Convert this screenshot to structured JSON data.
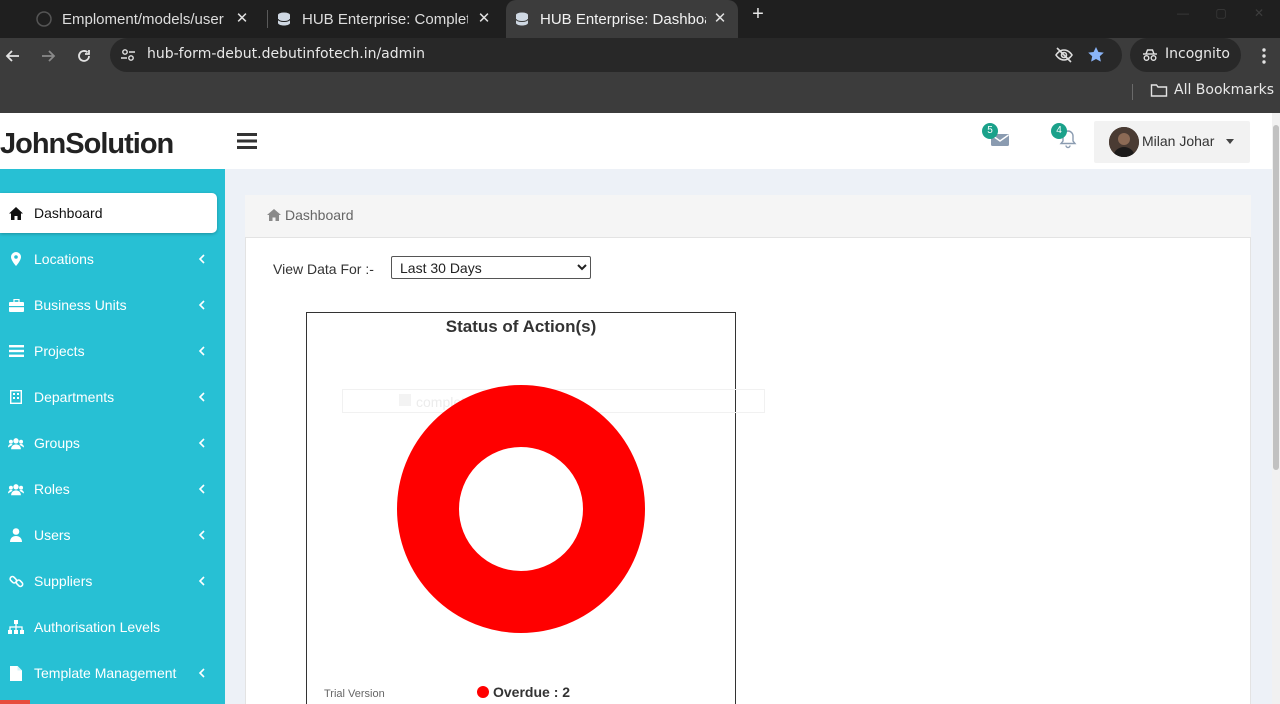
{
  "browser": {
    "tabs": [
      {
        "title": "Emploment/models/user",
        "active": false
      },
      {
        "title": "HUB Enterprise: Complete",
        "active": false
      },
      {
        "title": "HUB Enterprise: Dashboard",
        "active": true
      }
    ],
    "url": "hub-form-debut.debutinfotech.in/admin",
    "incognito_label": "Incognito",
    "bookmarks_label": "All Bookmarks"
  },
  "app": {
    "brand": "JohnSolution",
    "mail_count": "5",
    "notification_count": "4",
    "user_name": "Milan Johar"
  },
  "sidebar": {
    "items": [
      {
        "label": "Dashboard",
        "icon": "home-icon",
        "active": true,
        "has_submenu": false
      },
      {
        "label": "Locations",
        "icon": "map-marker-icon",
        "active": false,
        "has_submenu": true
      },
      {
        "label": "Business Units",
        "icon": "briefcase-icon",
        "active": false,
        "has_submenu": true
      },
      {
        "label": "Projects",
        "icon": "list-icon",
        "active": false,
        "has_submenu": true
      },
      {
        "label": "Departments",
        "icon": "building-icon",
        "active": false,
        "has_submenu": true
      },
      {
        "label": "Groups",
        "icon": "users-icon",
        "active": false,
        "has_submenu": true
      },
      {
        "label": "Roles",
        "icon": "users-icon",
        "active": false,
        "has_submenu": true
      },
      {
        "label": "Users",
        "icon": "user-icon",
        "active": false,
        "has_submenu": true
      },
      {
        "label": "Suppliers",
        "icon": "link-icon",
        "active": false,
        "has_submenu": true
      },
      {
        "label": "Authorisation Levels",
        "icon": "sitemap-icon",
        "active": false,
        "has_submenu": false
      },
      {
        "label": "Template Management",
        "icon": "file-icon",
        "active": false,
        "has_submenu": true
      }
    ]
  },
  "content": {
    "breadcrumb": "Dashboard",
    "view_label": "View Data For :-",
    "range_options": [
      "Last 30 Days"
    ],
    "range_selected": "Last 30 Days",
    "trial_label": "Trial Version",
    "ghost_label": "completed_forms"
  },
  "colors": {
    "sidebar": "#27c0d4",
    "badge": "#1aa18a",
    "overdue": "#ff0000"
  },
  "chart_data": {
    "type": "pie",
    "variant": "donut",
    "title": "Status of Action(s)",
    "categories": [
      "Overdue"
    ],
    "values": [
      2
    ],
    "legend": [
      "Overdue : 2"
    ],
    "legend_placement": "bottom",
    "colors": [
      "#ff0000"
    ]
  }
}
